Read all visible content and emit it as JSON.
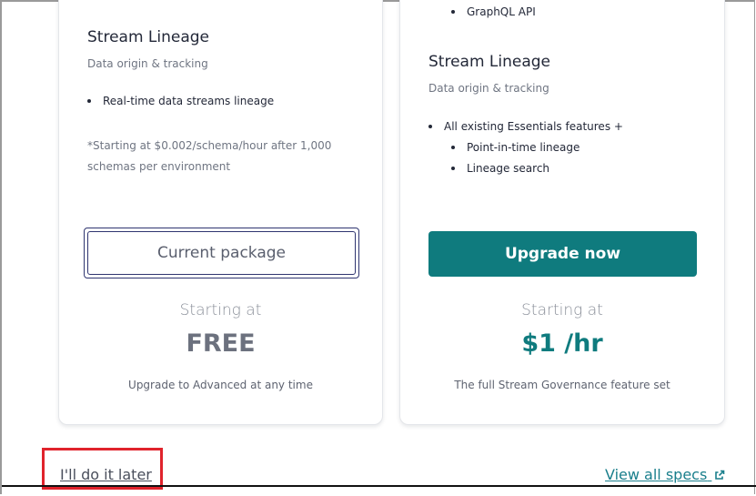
{
  "left_card": {
    "title": "Stream Lineage",
    "subtitle": "Data origin & tracking",
    "features": [
      "Real-time data streams lineage"
    ],
    "note": "*Starting at $0.002/schema/hour after 1,000 schemas per environment",
    "button_label": "Current package",
    "price_label": "Starting at",
    "price_value": "FREE",
    "price_note": "Upgrade to Advanced at any time"
  },
  "right_card": {
    "partial_top_feature": "GraphQL API",
    "title": "Stream Lineage",
    "subtitle": "Data origin & tracking",
    "features": [
      {
        "label": "All existing Essentials features +",
        "level": 0
      },
      {
        "label": "Point-in-time lineage",
        "level": 1
      },
      {
        "label": "Lineage search",
        "level": 1
      }
    ],
    "button_label": "Upgrade now",
    "price_label": "Starting at",
    "price_value": "$1 /hr",
    "price_note": "The full Stream Governance feature set"
  },
  "footer": {
    "later_link": "I'll do it later",
    "specs_link": "View all specs",
    "specs_icon": "external-link-icon"
  },
  "colors": {
    "accent": "#0f7b7e",
    "button_border": "#2f3570",
    "highlight": "#e0232c"
  }
}
